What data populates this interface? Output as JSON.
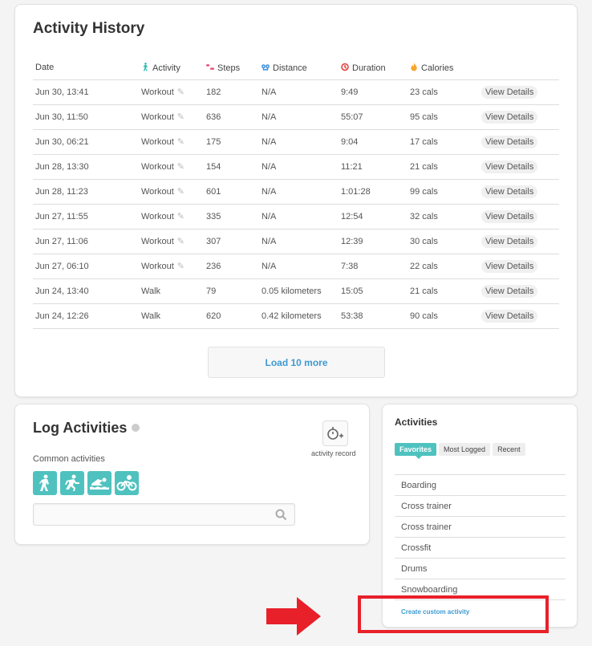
{
  "history": {
    "title": "Activity History",
    "columns": [
      {
        "label": "Date",
        "icon": ""
      },
      {
        "label": "Activity",
        "icon": "walker-icon",
        "color": "#1fb5ad"
      },
      {
        "label": "Steps",
        "icon": "footsteps-icon",
        "color": "#e94e77"
      },
      {
        "label": "Distance",
        "icon": "map-pins-icon",
        "color": "#3d8fe0"
      },
      {
        "label": "Duration",
        "icon": "clock-icon",
        "color": "#e53935"
      },
      {
        "label": "Calories",
        "icon": "flame-icon",
        "color": "#f7a531"
      },
      {
        "label": "",
        "icon": ""
      }
    ],
    "rows": [
      [
        "Jun 30, 13:41",
        "Workout",
        "182",
        "N/A",
        "9:49",
        "23 cals",
        "View Details"
      ],
      [
        "Jun 30, 11:50",
        "Workout",
        "636",
        "N/A",
        "55:07",
        "95 cals",
        "View Details"
      ],
      [
        "Jun 30, 06:21",
        "Workout",
        "175",
        "N/A",
        "9:04",
        "17 cals",
        "View Details"
      ],
      [
        "Jun 28, 13:30",
        "Workout",
        "154",
        "N/A",
        "11:21",
        "21 cals",
        "View Details"
      ],
      [
        "Jun 28, 11:23",
        "Workout",
        "601",
        "N/A",
        "1:01:28",
        "99 cals",
        "View Details"
      ],
      [
        "Jun 27, 11:55",
        "Workout",
        "335",
        "N/A",
        "12:54",
        "32 cals",
        "View Details"
      ],
      [
        "Jun 27, 11:06",
        "Workout",
        "307",
        "N/A",
        "12:39",
        "30 cals",
        "View Details"
      ],
      [
        "Jun 27, 06:10",
        "Workout",
        "236",
        "N/A",
        "7:38",
        "22 cals",
        "View Details"
      ],
      [
        "Jun 24, 13:40",
        "Walk",
        "79",
        "0.05 kilometers",
        "15:05",
        "21 cals",
        "View Details"
      ],
      [
        "Jun 24, 12:26",
        "Walk",
        "620",
        "0.42 kilometers",
        "53:38",
        "90 cals",
        "View Details"
      ]
    ],
    "load_more": "Load 10 more"
  },
  "log": {
    "title": "Log Activities",
    "common_label": "Common activities",
    "common_icons": [
      "walk-icon",
      "run-icon",
      "swim-icon",
      "bike-icon"
    ],
    "search_placeholder": "",
    "record_label": "activity record"
  },
  "activities": {
    "title": "Activities",
    "tabs": [
      "Favorites",
      "Most Logged",
      "Recent"
    ],
    "active_tab": "Favorites",
    "items": [
      "Boarding",
      "Cross trainer",
      "Cross trainer",
      "Crossfit",
      "Drums",
      "Snowboarding"
    ],
    "create_link": "Create custom activity"
  },
  "colors": {
    "accent": "#4fc2bf",
    "link": "#3d9ad1",
    "highlight": "#e8202a"
  }
}
